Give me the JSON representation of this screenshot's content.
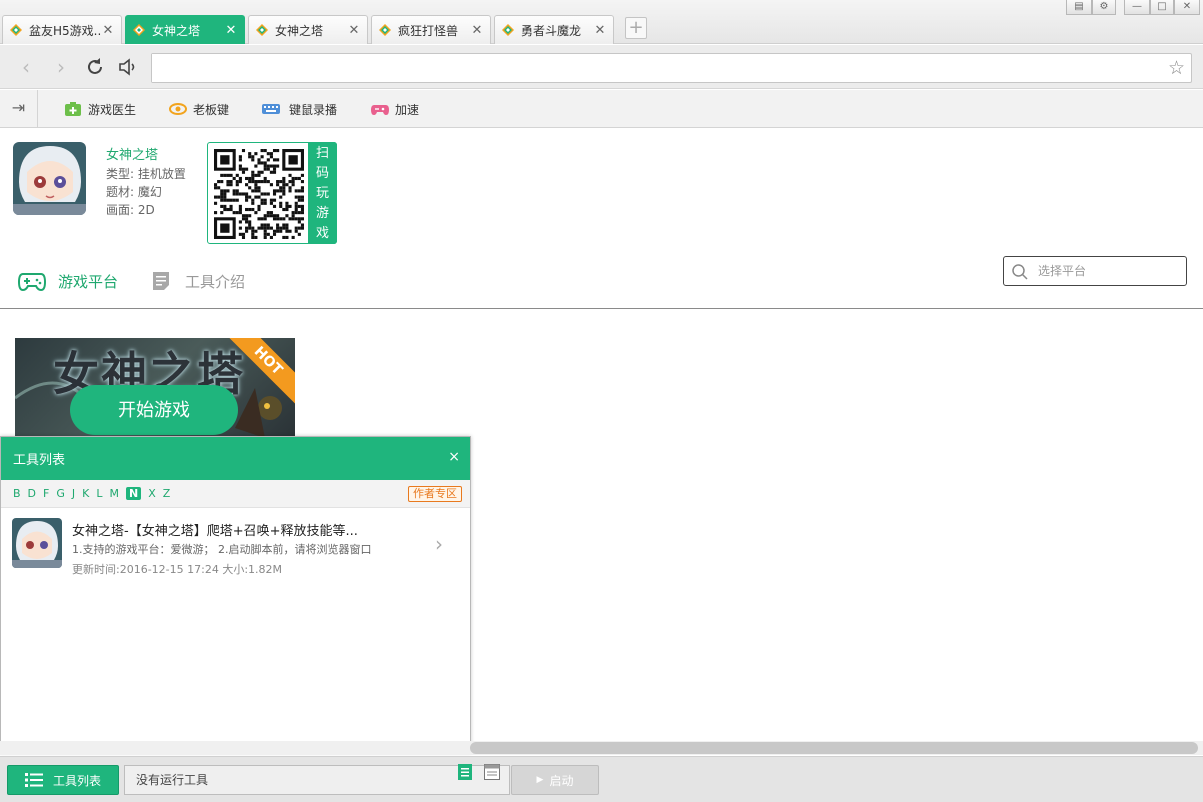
{
  "tabs": [
    {
      "label": "盆友H5游戏...",
      "active": false
    },
    {
      "label": "女神之塔",
      "active": true
    },
    {
      "label": "女神之塔",
      "active": false
    },
    {
      "label": "疯狂打怪兽",
      "active": false
    },
    {
      "label": "勇者斗魔龙",
      "active": false
    }
  ],
  "new_tab_label": "+",
  "window_buttons": [
    "▤",
    "⚙",
    "—",
    "□",
    "✕"
  ],
  "address": {
    "value": "",
    "placeholder": ""
  },
  "toolbar": {
    "items": [
      {
        "label": "游戏医生",
        "icon": "first-aid-icon",
        "color": "#6dbf4a"
      },
      {
        "label": "老板键",
        "icon": "eye-icon",
        "color": "#f2a41e"
      },
      {
        "label": "键鼠录播",
        "icon": "keyboard-icon",
        "color": "#4f8fd8"
      },
      {
        "label": "加速",
        "icon": "gamepad-icon",
        "color": "#e9608e"
      }
    ]
  },
  "game": {
    "name": "女神之塔",
    "type": "类型: 挂机放置",
    "theme": "题材: 魔幻",
    "graphics": "画面: 2D",
    "qr_label": [
      "扫",
      "码",
      "玩",
      "游",
      "戏"
    ]
  },
  "content_tabs": [
    {
      "label": "游戏平台",
      "icon": "gamepad-icon",
      "active": true
    },
    {
      "label": "工具介绍",
      "icon": "document-icon",
      "active": false
    }
  ],
  "platform_search": {
    "placeholder": "选择平台"
  },
  "banner": {
    "title": "女神之塔",
    "hot": "HOT",
    "start_label": "开始游戏"
  },
  "tool_panel": {
    "title": "工具列表",
    "close": "×",
    "alphabet": [
      "B",
      "D",
      "F",
      "G",
      "J",
      "K",
      "L",
      "M",
      "N",
      "X",
      "Z"
    ],
    "selected_letter": "N",
    "author_zone": "作者专区",
    "tools": [
      {
        "title": "女神之塔-【女神之塔】爬塔+召唤+释放技能等...",
        "desc": "1.支持的游戏平台：爱微游； 2.启动脚本前，请将浏览器窗口",
        "meta": "更新时间:2016-12-15 17:24 大小:1.82M"
      }
    ]
  },
  "statusbar": {
    "tool_list_label": "工具列表",
    "status_text": "没有运行工具",
    "launch_label": "启动"
  },
  "colors": {
    "accent": "#1fb57d",
    "hot": "#f39a1f",
    "author": "#e8791e"
  }
}
